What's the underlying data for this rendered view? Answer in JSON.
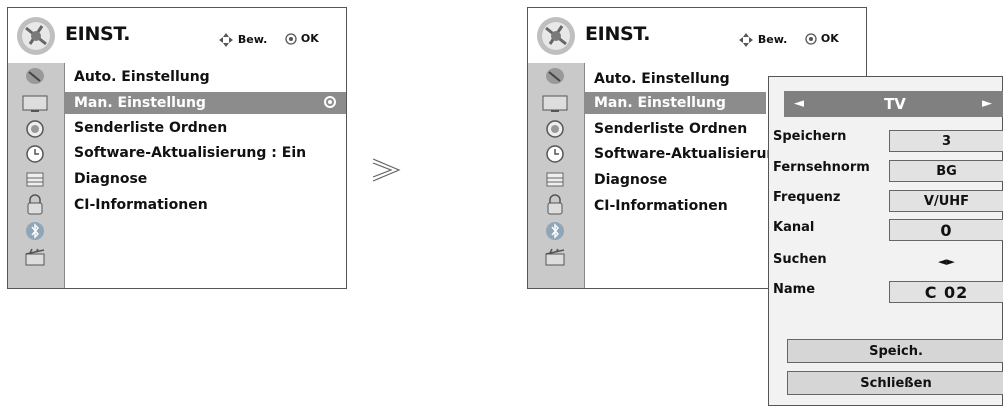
{
  "left_menu": {
    "title": "EINST.",
    "hint_move": "Bew.",
    "hint_ok": "OK",
    "items": [
      "Auto. Einstellung",
      "Man. Einstellung",
      "Senderliste Ordnen",
      "Software-Aktualisierung : Ein",
      "Diagnose",
      "CI-Informationen"
    ],
    "selected_index": 1
  },
  "right_menu": {
    "title": "EINST.",
    "hint_move": "Bew.",
    "hint_ok": "OK",
    "items": [
      "Auto. Einstellung",
      "Man. Einstellung",
      "Senderliste Ordnen",
      "Software-Aktualisierung :",
      "Diagnose",
      "CI-Informationen"
    ],
    "selected_index": 1
  },
  "sidebar_icons": [
    "satellite-dish-icon",
    "tv-icon",
    "speaker-icon",
    "clock-icon",
    "lock-box-icon",
    "padlock-icon",
    "bluetooth-icon",
    "clapperboard-icon"
  ],
  "popup": {
    "header_value": "TV",
    "header_left": "◄",
    "header_right": "►",
    "rows": [
      {
        "label": "Speichern",
        "value": "3"
      },
      {
        "label": "Fernsehnorm",
        "value": "BG"
      },
      {
        "label": "Frequenz",
        "value": "V/UHF"
      },
      {
        "label": "Kanal",
        "value": "0"
      },
      {
        "label": "Suchen",
        "value": "◄►"
      },
      {
        "label": "Name",
        "value": "C  02"
      }
    ],
    "buttons": {
      "store": "Speich.",
      "close": "Schließen"
    }
  },
  "separator": "≫"
}
